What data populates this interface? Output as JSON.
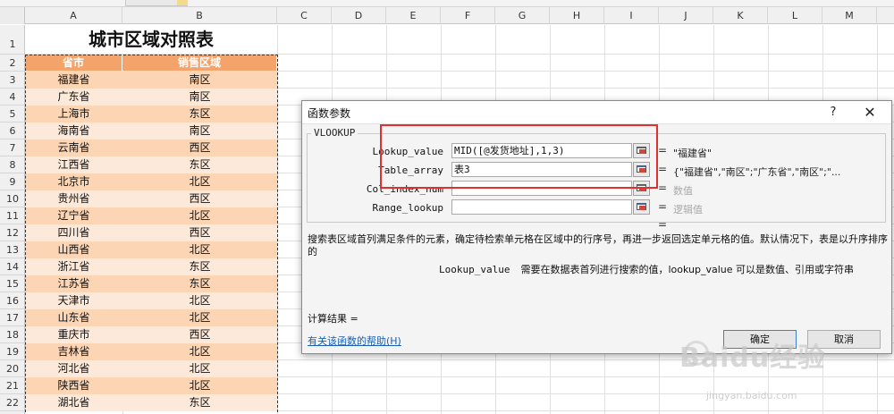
{
  "sheet": {
    "columns": [
      "A",
      "B",
      "C",
      "D",
      "E",
      "F",
      "G",
      "H",
      "I",
      "J",
      "K",
      "L",
      "M"
    ],
    "rows": [
      "1",
      "2",
      "3",
      "4",
      "5",
      "6",
      "7",
      "8",
      "9",
      "10",
      "11",
      "12",
      "13",
      "14",
      "15",
      "16",
      "17",
      "18",
      "19",
      "20",
      "21",
      "22"
    ],
    "table_title": "城市区域对照表",
    "header_province": "省市",
    "header_region": "销售区域",
    "data": [
      {
        "province": "福建省",
        "region": "南区"
      },
      {
        "province": "广东省",
        "region": "南区"
      },
      {
        "province": "上海市",
        "region": "东区"
      },
      {
        "province": "海南省",
        "region": "南区"
      },
      {
        "province": "云南省",
        "region": "西区"
      },
      {
        "province": "江西省",
        "region": "东区"
      },
      {
        "province": "北京市",
        "region": "北区"
      },
      {
        "province": "贵州省",
        "region": "西区"
      },
      {
        "province": "辽宁省",
        "region": "北区"
      },
      {
        "province": "四川省",
        "region": "西区"
      },
      {
        "province": "山西省",
        "region": "北区"
      },
      {
        "province": "浙江省",
        "region": "东区"
      },
      {
        "province": "江苏省",
        "region": "东区"
      },
      {
        "province": "天津市",
        "region": "北区"
      },
      {
        "province": "山东省",
        "region": "北区"
      },
      {
        "province": "重庆市",
        "region": "西区"
      },
      {
        "province": "吉林省",
        "region": "北区"
      },
      {
        "province": "河北省",
        "region": "北区"
      },
      {
        "province": "陕西省",
        "region": "北区"
      },
      {
        "province": "湖北省",
        "region": "东区"
      }
    ],
    "colors": {
      "header_bg": "#f4a46a",
      "row_odd": "#fcd5b4",
      "row_even": "#fde9d9"
    }
  },
  "dialog": {
    "title": "函数参数",
    "help": "?",
    "close": "✕",
    "function_name": "VLOOKUP",
    "args": [
      {
        "label": "Lookup_value",
        "value": "MID([@发货地址],1,3)",
        "result": "\"福建省\"",
        "result_gray": false
      },
      {
        "label": "Table_array",
        "value": "表3",
        "result": "{\"福建省\",\"南区\";\"广东省\",\"南区\";\"...",
        "result_gray": false
      },
      {
        "label": "Col_index_num",
        "value": "",
        "result": "数值",
        "result_gray": true
      },
      {
        "label": "Range_lookup",
        "value": "",
        "result": "逻辑值",
        "result_gray": true
      }
    ],
    "equals": "=",
    "description": "搜索表区域首列满足条件的元素，确定待检索单元格在区域中的行序号，再进一步返回选定单元格的值。默认情况下，表是以升序排序的",
    "param_name": "Lookup_value",
    "param_description": "需要在数据表首列进行搜索的值，lookup_value 可以是数值、引用或字符串",
    "calc_result": "计算结果 =",
    "help_link": "有关该函数的帮助(H)",
    "ok": "确定",
    "cancel": "取消"
  },
  "watermark": {
    "text": "Baidu经验",
    "url": "jingyan.baidu.com"
  }
}
